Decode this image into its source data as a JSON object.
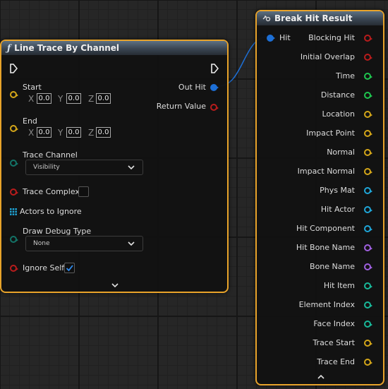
{
  "colors": {
    "node_border": "#e8a32a",
    "header": "#3a4552",
    "pin_red": "#b81c1c",
    "pin_yellow": "#d4a619",
    "pin_green": "#1fc64f",
    "pin_teal": "#19b99a",
    "pin_cyan": "#1fa6d8",
    "pin_purple": "#a060e0",
    "pin_blue": "#1d6fd6",
    "pin_dark_teal": "#137367",
    "wire": "#1d6fd6"
  },
  "line_trace": {
    "title": "Line Trace By Channel",
    "title_icon": "function-icon",
    "start": {
      "label": "Start",
      "x": "0.0",
      "y": "0.0",
      "z": "0.0"
    },
    "end": {
      "label": "End",
      "x": "0.0",
      "y": "0.0",
      "z": "0.0"
    },
    "axis_x": "X",
    "axis_y": "Y",
    "axis_z": "Z",
    "trace_channel": {
      "label": "Trace Channel",
      "value": "Visibility"
    },
    "trace_complex": {
      "label": "Trace Complex",
      "checked": false
    },
    "actors_to_ignore": "Actors to Ignore",
    "draw_debug_type": {
      "label": "Draw Debug Type",
      "value": "None"
    },
    "ignore_self": {
      "label": "Ignore Self",
      "checked": true
    },
    "out_hit": "Out Hit",
    "return_value": "Return Value"
  },
  "break_hit": {
    "title": "Break Hit Result",
    "title_icon": "break-struct-icon",
    "input": "Hit",
    "outputs": [
      {
        "label": "Blocking Hit",
        "pin": "bool",
        "color": "#b81c1c"
      },
      {
        "label": "Initial Overlap",
        "pin": "bool",
        "color": "#b81c1c"
      },
      {
        "label": "Time",
        "pin": "float",
        "color": "#1fc64f"
      },
      {
        "label": "Distance",
        "pin": "float",
        "color": "#1fc64f"
      },
      {
        "label": "Location",
        "pin": "vector",
        "color": "#d4a619"
      },
      {
        "label": "Impact Point",
        "pin": "vector",
        "color": "#d4a619"
      },
      {
        "label": "Normal",
        "pin": "vector",
        "color": "#d4a619"
      },
      {
        "label": "Impact Normal",
        "pin": "vector",
        "color": "#d4a619"
      },
      {
        "label": "Phys Mat",
        "pin": "object",
        "color": "#1fa6d8"
      },
      {
        "label": "Hit Actor",
        "pin": "object",
        "color": "#1fa6d8"
      },
      {
        "label": "Hit Component",
        "pin": "object",
        "color": "#1fa6d8"
      },
      {
        "label": "Hit Bone Name",
        "pin": "name",
        "color": "#a060e0"
      },
      {
        "label": "Bone Name",
        "pin": "name",
        "color": "#a060e0"
      },
      {
        "label": "Hit Item",
        "pin": "int",
        "color": "#19b99a"
      },
      {
        "label": "Element Index",
        "pin": "int",
        "color": "#19b99a"
      },
      {
        "label": "Face Index",
        "pin": "int",
        "color": "#19b99a"
      },
      {
        "label": "Trace Start",
        "pin": "vector",
        "color": "#d4a619"
      },
      {
        "label": "Trace End",
        "pin": "vector",
        "color": "#d4a619"
      }
    ]
  }
}
